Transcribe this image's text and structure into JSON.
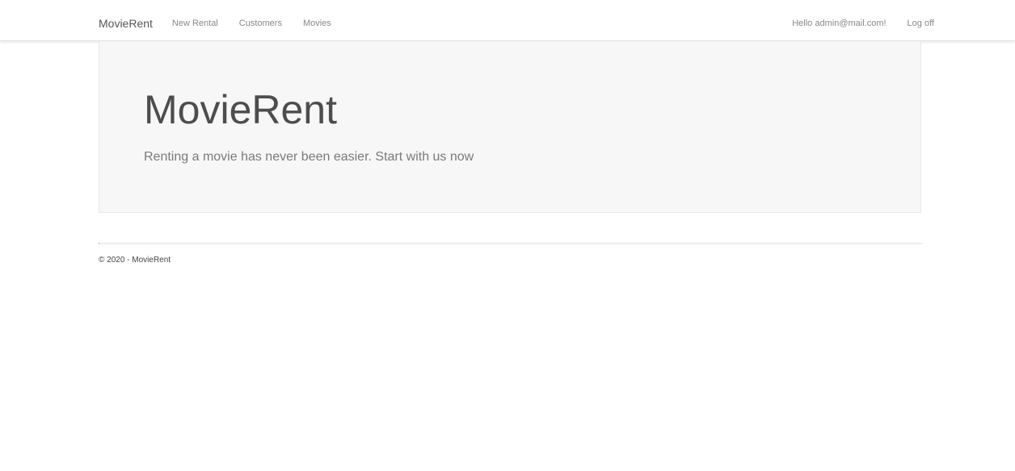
{
  "navbar": {
    "brand": "MovieRent",
    "links": [
      {
        "label": "New Rental"
      },
      {
        "label": "Customers"
      },
      {
        "label": "Movies"
      }
    ],
    "greeting": "Hello admin@mail.com!",
    "logoff": "Log off"
  },
  "jumbotron": {
    "title": "MovieRent",
    "lead": "Renting a movie has never been easier. Start with us now"
  },
  "footer": {
    "text": "© 2020 - MovieRent"
  }
}
